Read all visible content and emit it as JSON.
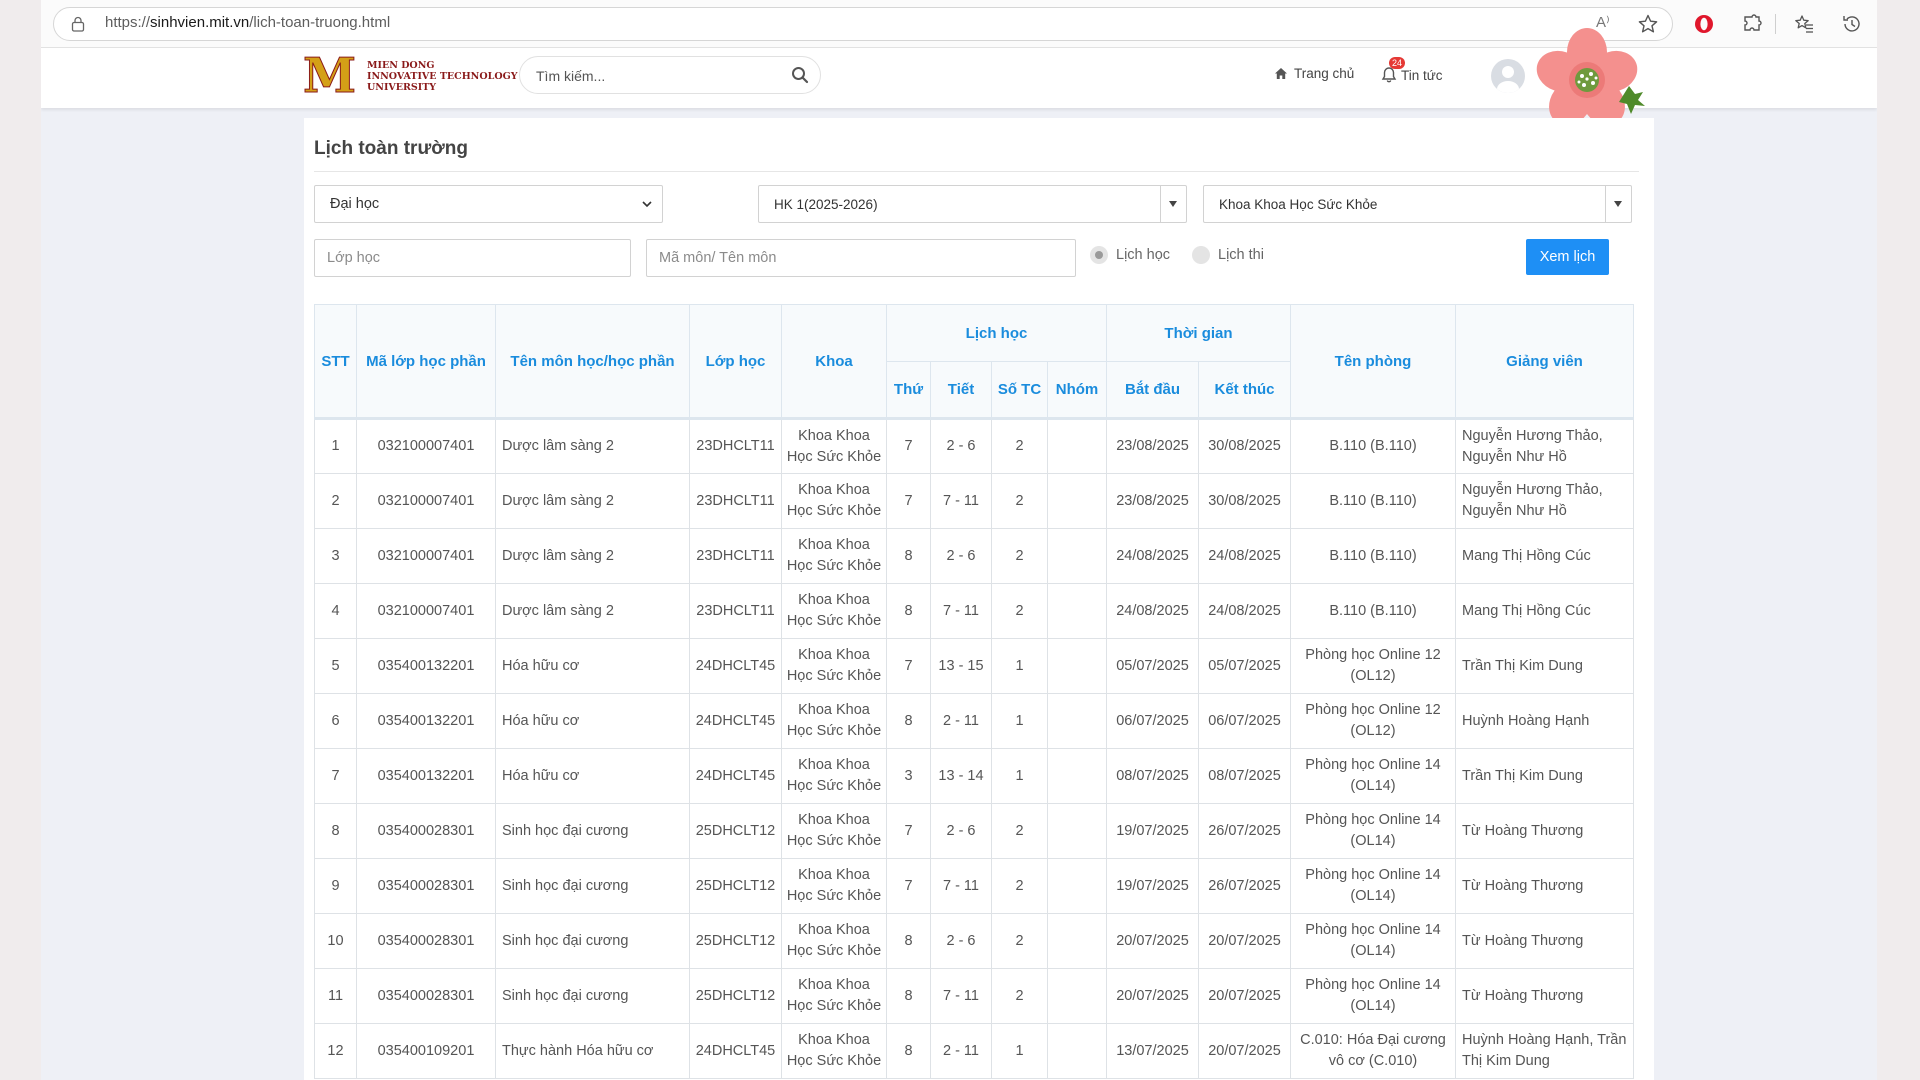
{
  "browser": {
    "url_prefix": "https://",
    "url_domain": "sinhvien.mit.vn",
    "url_path": "/lich-toan-truong.html",
    "read_aloud": "A⁾"
  },
  "header": {
    "logo_letter": "M",
    "logo_line1": "MIEN DONG",
    "logo_line2": "INNOVATIVE TECHNOLOGY",
    "logo_line3": "UNIVERSITY",
    "search_placeholder": "Tìm kiếm...",
    "nav_home": "Trang chủ",
    "nav_news": "Tin tức",
    "news_badge": "24"
  },
  "page": {
    "title": "Lịch toàn trường",
    "filters": {
      "level": "Đại học",
      "semester": "HK 1(2025-2026)",
      "faculty": "Khoa Khoa Học Sức Khỏe",
      "class_placeholder": "Lớp học",
      "course_placeholder": "Mã môn/ Tên môn",
      "radio_schedule": "Lịch học",
      "radio_exam": "Lịch thi",
      "submit": "Xem lịch"
    }
  },
  "table": {
    "headers": {
      "stt": "STT",
      "ma_lop": "Mã lớp học phần",
      "ten_mon": "Tên môn học/học phần",
      "lop_hoc": "Lớp học",
      "khoa": "Khoa",
      "lich_hoc": "Lịch học",
      "thu": "Thứ",
      "tiet": "Tiết",
      "so_tc": "Số TC",
      "nhom": "Nhóm",
      "thoi_gian": "Thời gian",
      "bat_dau": "Bắt đầu",
      "ket_thuc": "Kết thúc",
      "ten_phong": "Tên phòng",
      "giang_vien": "Giảng viên"
    },
    "rows": [
      {
        "stt": "1",
        "ma": "032100007401",
        "ten": "Dược lâm sàng 2",
        "lop": "23DHCLT11",
        "khoa": "Khoa Khoa Học Sức Khỏe",
        "thu": "7",
        "tiet": "2 - 6",
        "tc": "2",
        "nhom": "",
        "bd": "23/08/2025",
        "kt": "30/08/2025",
        "phong": "B.110 (B.110)",
        "gv": "Nguyễn Hương Thảo, Nguyễn Như Hồ"
      },
      {
        "stt": "2",
        "ma": "032100007401",
        "ten": "Dược lâm sàng 2",
        "lop": "23DHCLT11",
        "khoa": "Khoa Khoa Học Sức Khỏe",
        "thu": "7",
        "tiet": "7 - 11",
        "tc": "2",
        "nhom": "",
        "bd": "23/08/2025",
        "kt": "30/08/2025",
        "phong": "B.110 (B.110)",
        "gv": "Nguyễn Hương Thảo, Nguyễn Như Hồ"
      },
      {
        "stt": "3",
        "ma": "032100007401",
        "ten": "Dược lâm sàng 2",
        "lop": "23DHCLT11",
        "khoa": "Khoa Khoa Học Sức Khỏe",
        "thu": "8",
        "tiet": "2 - 6",
        "tc": "2",
        "nhom": "",
        "bd": "24/08/2025",
        "kt": "24/08/2025",
        "phong": "B.110 (B.110)",
        "gv": "Mang Thị Hồng Cúc"
      },
      {
        "stt": "4",
        "ma": "032100007401",
        "ten": "Dược lâm sàng 2",
        "lop": "23DHCLT11",
        "khoa": "Khoa Khoa Học Sức Khỏe",
        "thu": "8",
        "tiet": "7 - 11",
        "tc": "2",
        "nhom": "",
        "bd": "24/08/2025",
        "kt": "24/08/2025",
        "phong": "B.110 (B.110)",
        "gv": "Mang Thị Hồng Cúc"
      },
      {
        "stt": "5",
        "ma": "035400132201",
        "ten": "Hóa hữu cơ",
        "lop": "24DHCLT45",
        "khoa": "Khoa Khoa Học Sức Khỏe",
        "thu": "7",
        "tiet": "13 - 15",
        "tc": "1",
        "nhom": "",
        "bd": "05/07/2025",
        "kt": "05/07/2025",
        "phong": "Phòng học Online 12 (OL12)",
        "gv": "Trần Thị Kim Dung"
      },
      {
        "stt": "6",
        "ma": "035400132201",
        "ten": "Hóa hữu cơ",
        "lop": "24DHCLT45",
        "khoa": "Khoa Khoa Học Sức Khỏe",
        "thu": "8",
        "tiet": "2 - 11",
        "tc": "1",
        "nhom": "",
        "bd": "06/07/2025",
        "kt": "06/07/2025",
        "phong": "Phòng học Online 12 (OL12)",
        "gv": "Huỳnh Hoàng Hạnh"
      },
      {
        "stt": "7",
        "ma": "035400132201",
        "ten": "Hóa hữu cơ",
        "lop": "24DHCLT45",
        "khoa": "Khoa Khoa Học Sức Khỏe",
        "thu": "3",
        "tiet": "13 - 14",
        "tc": "1",
        "nhom": "",
        "bd": "08/07/2025",
        "kt": "08/07/2025",
        "phong": "Phòng học Online 14 (OL14)",
        "gv": "Trần Thị Kim Dung"
      },
      {
        "stt": "8",
        "ma": "035400028301",
        "ten": "Sinh học đại cương",
        "lop": "25DHCLT12",
        "khoa": "Khoa Khoa Học Sức Khỏe",
        "thu": "7",
        "tiet": "2 - 6",
        "tc": "2",
        "nhom": "",
        "bd": "19/07/2025",
        "kt": "26/07/2025",
        "phong": "Phòng học Online 14 (OL14)",
        "gv": "Từ Hoàng Thương"
      },
      {
        "stt": "9",
        "ma": "035400028301",
        "ten": "Sinh học đại cương",
        "lop": "25DHCLT12",
        "khoa": "Khoa Khoa Học Sức Khỏe",
        "thu": "7",
        "tiet": "7 - 11",
        "tc": "2",
        "nhom": "",
        "bd": "19/07/2025",
        "kt": "26/07/2025",
        "phong": "Phòng học Online 14 (OL14)",
        "gv": "Từ Hoàng Thương"
      },
      {
        "stt": "10",
        "ma": "035400028301",
        "ten": "Sinh học đại cương",
        "lop": "25DHCLT12",
        "khoa": "Khoa Khoa Học Sức Khỏe",
        "thu": "8",
        "tiet": "2 - 6",
        "tc": "2",
        "nhom": "",
        "bd": "20/07/2025",
        "kt": "20/07/2025",
        "phong": "Phòng học Online 14 (OL14)",
        "gv": "Từ Hoàng Thương"
      },
      {
        "stt": "11",
        "ma": "035400028301",
        "ten": "Sinh học đại cương",
        "lop": "25DHCLT12",
        "khoa": "Khoa Khoa Học Sức Khỏe",
        "thu": "8",
        "tiet": "7 - 11",
        "tc": "2",
        "nhom": "",
        "bd": "20/07/2025",
        "kt": "20/07/2025",
        "phong": "Phòng học Online 14 (OL14)",
        "gv": "Từ Hoàng Thương"
      },
      {
        "stt": "12",
        "ma": "035400109201",
        "ten": "Thực hành Hóa hữu cơ",
        "lop": "24DHCLT45",
        "khoa": "Khoa Khoa Học Sức Khỏe",
        "thu": "8",
        "tiet": "2 - 11",
        "tc": "1",
        "nhom": "",
        "bd": "13/07/2025",
        "kt": "20/07/2025",
        "phong": "C.010: Hóa Đại cương vô cơ (C.010)",
        "gv": "Huỳnh Hoàng Hạnh, Trần Thị Kim Dung"
      }
    ]
  }
}
